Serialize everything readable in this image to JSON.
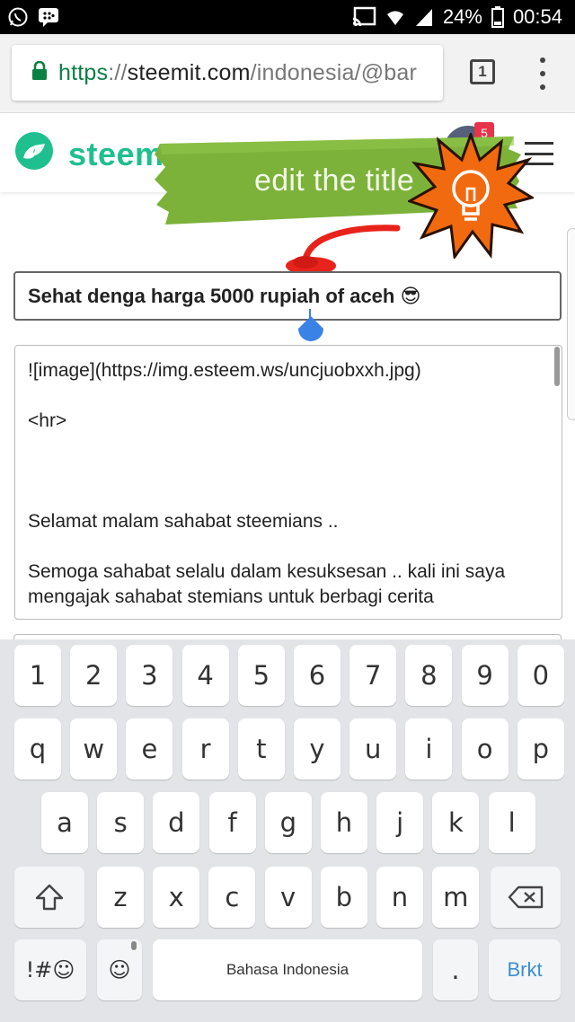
{
  "status_bar": {
    "battery_percent": "24%",
    "time": "00:54",
    "icons": [
      "whatsapp-icon",
      "bbm-icon",
      "cast-icon",
      "wifi-icon",
      "signal-icon",
      "battery-icon"
    ]
  },
  "browser": {
    "url_scheme": "https",
    "url_sep": "://",
    "url_host": "steemit.com",
    "url_path": "/indonesia/@bar",
    "tab_count": "1"
  },
  "site": {
    "logo_text": "steem",
    "notification_count": "5"
  },
  "annotation": {
    "banner_text": "edit the title"
  },
  "editor": {
    "title_value": "Sehat denga harga 5000 rupiah of aceh 😎",
    "body_lines": [
      "![image](https://img.esteem.ws/uncjuobxxh.jpg)",
      "",
      "<hr>",
      "",
      "",
      "",
      "Selamat malam sahabat steemians ..",
      "",
      "Semoga sahabat selalu dalam kesuksesan .. kali ini saya",
      "mengajak sahabat stemians untuk berbagi cerita"
    ]
  },
  "keyboard": {
    "row_numbers": [
      "1",
      "2",
      "3",
      "4",
      "5",
      "6",
      "7",
      "8",
      "9",
      "0"
    ],
    "row_top": [
      "q",
      "w",
      "e",
      "r",
      "t",
      "y",
      "u",
      "i",
      "o",
      "p"
    ],
    "row_middle": [
      "a",
      "s",
      "d",
      "f",
      "g",
      "h",
      "j",
      "k",
      "l"
    ],
    "row_bottom": [
      "z",
      "x",
      "c",
      "v",
      "b",
      "n",
      "m"
    ],
    "symbols_key": "!#☺",
    "emoji_key": "☺",
    "space_label": "Bahasa Indonesia",
    "period_key": ".",
    "enter_label": "Brkt",
    "shift_icon": "shift-icon",
    "backspace_icon": "backspace-icon"
  },
  "colors": {
    "steem_green": "#1fbf8f",
    "banner_green": "#7cb23a",
    "bulb_orange": "#f26a0f",
    "url_green": "#0b8043",
    "badge_red": "#e6334a",
    "caret_blue": "#3b82e6",
    "keyboard_bg": "#e3e4e8"
  }
}
